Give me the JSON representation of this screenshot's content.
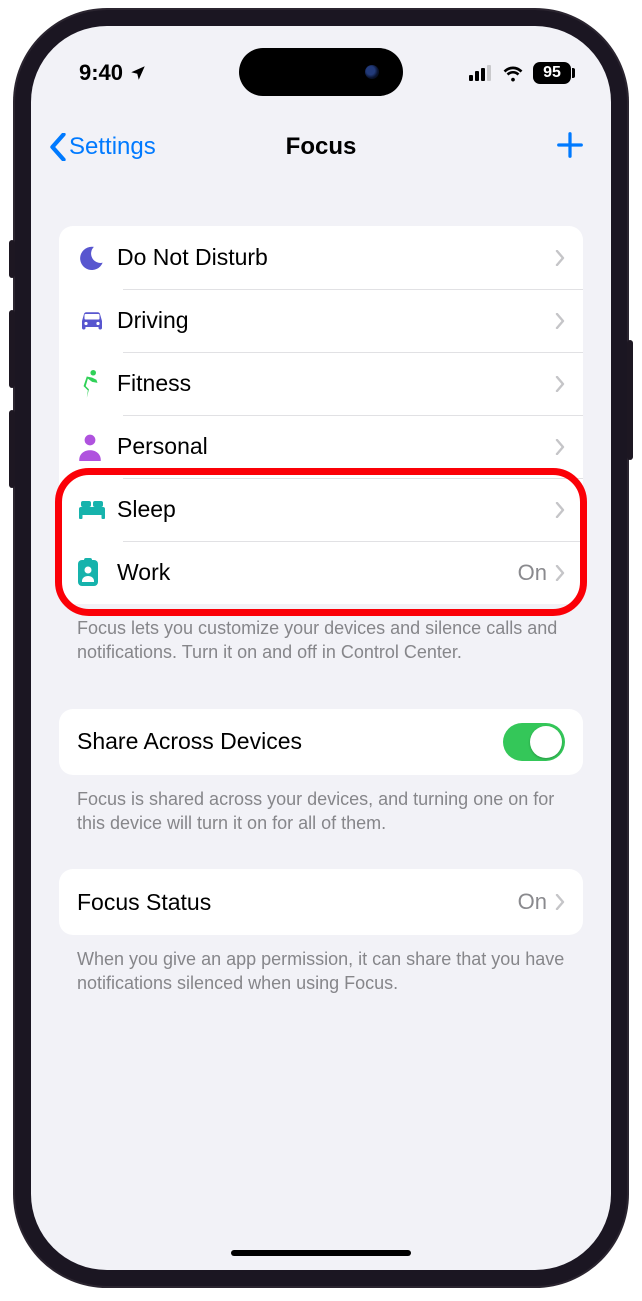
{
  "statusbar": {
    "time": "9:40",
    "battery": "95"
  },
  "nav": {
    "back": "Settings",
    "title": "Focus"
  },
  "focus_modes": [
    {
      "icon": "moon",
      "color": "#5856cf",
      "label": "Do Not Disturb",
      "value": ""
    },
    {
      "icon": "car",
      "color": "#5856cf",
      "label": "Driving",
      "value": ""
    },
    {
      "icon": "fitness",
      "color": "#30d158",
      "label": "Fitness",
      "value": ""
    },
    {
      "icon": "person",
      "color": "#af52de",
      "label": "Personal",
      "value": ""
    },
    {
      "icon": "bed",
      "color": "#16b3ac",
      "label": "Sleep",
      "value": ""
    },
    {
      "icon": "badge",
      "color": "#16b3ac",
      "label": "Work",
      "value": "On"
    }
  ],
  "focus_footer": "Focus lets you customize your devices and silence calls and notifications. Turn it on and off in Control Center.",
  "share": {
    "label": "Share Across Devices",
    "footer": "Focus is shared across your devices, and turning one on for this device will turn it on for all of them."
  },
  "status": {
    "label": "Focus Status",
    "value": "On",
    "footer": "When you give an app permission, it can share that you have notifications silenced when using Focus."
  },
  "icon_colors": {
    "moon_purple": "#5856cf",
    "car_purple": "#5856cf",
    "fitness_green": "#30d158",
    "person_purple": "#af52de",
    "sleep_teal": "#16b3ac",
    "work_teal": "#16b3ac"
  }
}
